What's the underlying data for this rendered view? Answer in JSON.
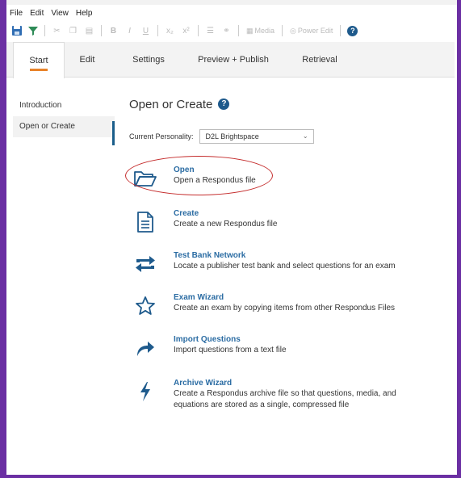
{
  "window": {
    "title": "Respondus"
  },
  "menu": [
    "File",
    "Edit",
    "View",
    "Help"
  ],
  "toolbar": {
    "media_label": "Media",
    "poweredit_label": "Power Edit"
  },
  "tabs": [
    {
      "label": "Start",
      "active": true
    },
    {
      "label": "Edit",
      "active": false
    },
    {
      "label": "Settings",
      "active": false
    },
    {
      "label": "Preview + Publish",
      "active": false
    },
    {
      "label": "Retrieval",
      "active": false
    }
  ],
  "sidebar": {
    "items": [
      {
        "label": "Introduction"
      },
      {
        "label": "Open or Create"
      }
    ]
  },
  "main": {
    "title": "Open or Create",
    "personality_label": "Current Personality:",
    "personality_value": "D2L Brightspace",
    "actions": [
      {
        "label": "Open",
        "desc": "Open a Respondus file",
        "icon": "folder-icon"
      },
      {
        "label": "Create",
        "desc": "Create a new Respondus file",
        "icon": "document-icon"
      },
      {
        "label": "Test Bank Network",
        "desc": "Locate a publisher test bank and select questions for an exam",
        "icon": "exchange-icon"
      },
      {
        "label": "Exam Wizard",
        "desc": "Create an exam by copying items from other Respondus Files",
        "icon": "star-icon"
      },
      {
        "label": "Import Questions",
        "desc": "Import questions from a text file",
        "icon": "share-arrow-icon"
      },
      {
        "label": "Archive Wizard",
        "desc": "Create a Respondus archive file so that questions, media, and equations are stored as a single, compressed file",
        "icon": "lightning-icon"
      }
    ]
  },
  "colors": {
    "frame": "#6b2fa3",
    "accent": "#1e5a8c",
    "link": "#2b6ca3",
    "tab_underline": "#e8832a",
    "annotation": "#c42b2b"
  }
}
